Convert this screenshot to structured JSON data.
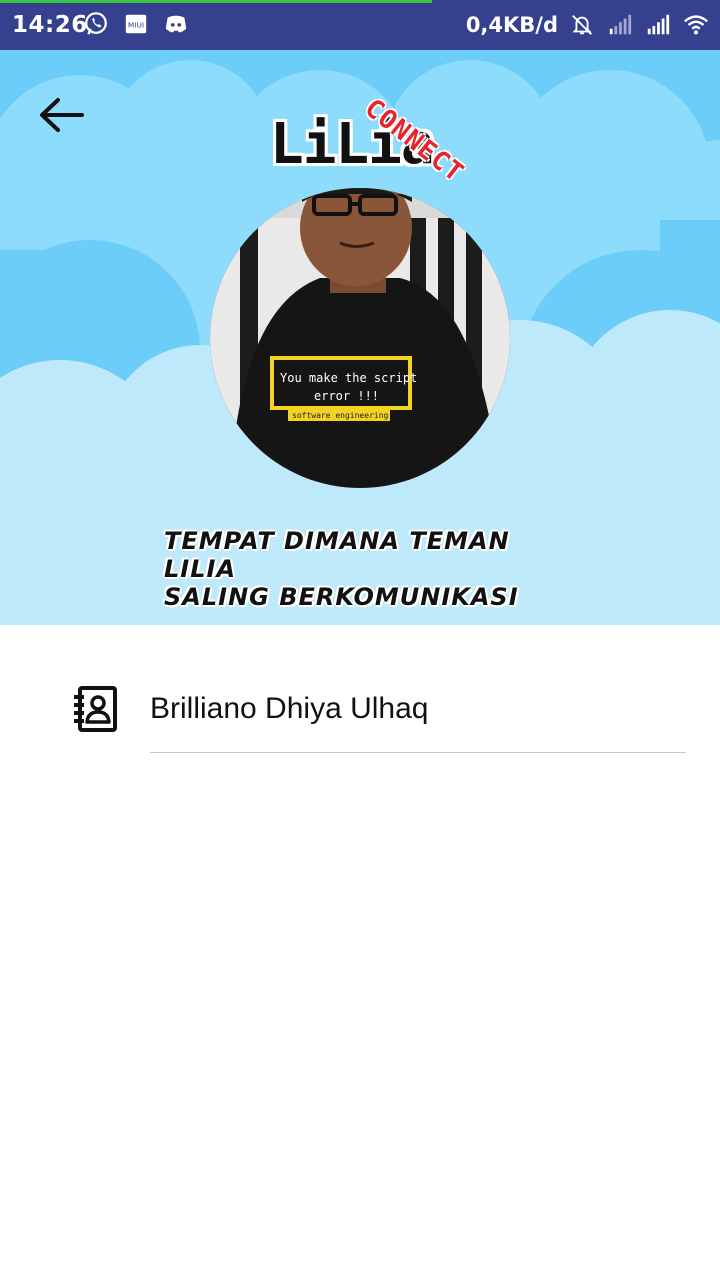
{
  "status_bar": {
    "time": "14:26",
    "left_icons": [
      "whatsapp-icon",
      "miui-icon",
      "discord-icon"
    ],
    "net_speed": "0,4KB/d",
    "right_icons": [
      "bell-off-icon",
      "signal-icon",
      "signal-icon",
      "wifi-icon"
    ]
  },
  "header": {
    "logo_text": "LiLia",
    "logo_badge": "CONNECT",
    "tagline_line1": "TEMPAT DIMANA TEMAN LILIA",
    "tagline_line2": "SALING BERKOMUNIKASI",
    "avatar_shirt_line1": "You make the script",
    "avatar_shirt_line2": "error !!!",
    "avatar_shirt_line3": "software engineering"
  },
  "contacts": [
    {
      "name": "Brilliano Dhiya Ulhaq",
      "icon": "contact-book-icon"
    }
  ],
  "colors": {
    "status_bar": "#35408f",
    "sky": "#6ccdf8",
    "cloud_light": "#bde9fb",
    "progress": "#38c43c"
  }
}
